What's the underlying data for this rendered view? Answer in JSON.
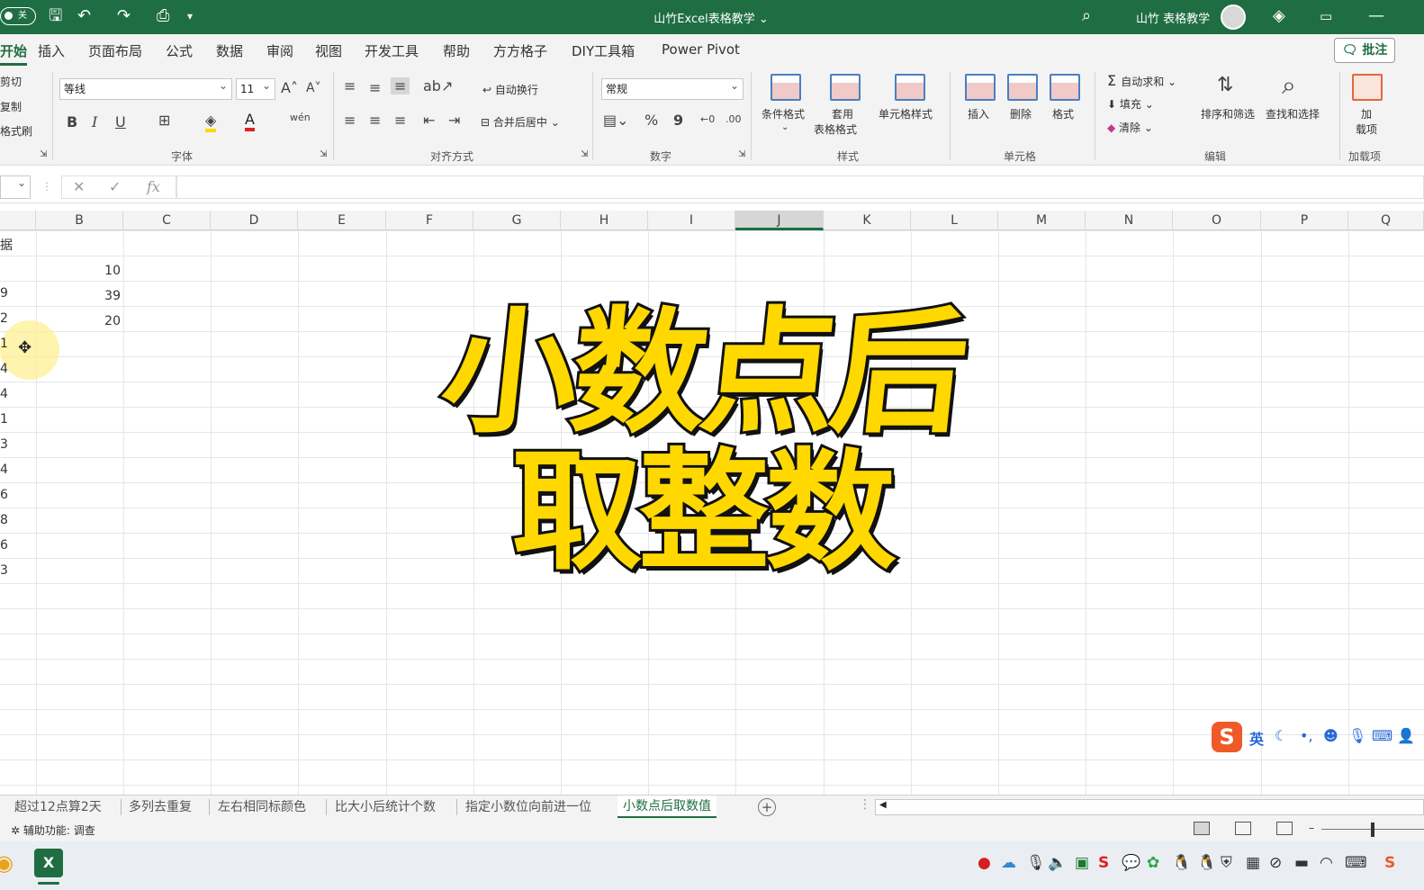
{
  "titlebar": {
    "autosave_toggle": "关",
    "doc_title": "山竹Excel表格教学 ⌄",
    "user_name": "山竹 表格教学"
  },
  "tabs": [
    "开始",
    "插入",
    "页面布局",
    "公式",
    "数据",
    "审阅",
    "视图",
    "开发工具",
    "帮助",
    "方方格子",
    "DIY工具箱",
    "Power Pivot"
  ],
  "comment_button": "批注",
  "clipboard": {
    "cut": "剪切",
    "copy": "复制",
    "format_painter": "格式刷"
  },
  "font": {
    "family": "等线",
    "size": "11",
    "bold": "B",
    "italic": "I",
    "underline": "U",
    "group_label": "字体"
  },
  "alignment": {
    "wrap_text": "自动换行",
    "merge_center": "合并后居中",
    "group_label": "对齐方式"
  },
  "number": {
    "format": "常规",
    "percent": "%",
    "comma": "9",
    "group_label": "数字"
  },
  "styles": {
    "conditional": "条件格式",
    "table_format_1": "套用",
    "table_format_2": "表格格式",
    "cell_styles": "单元格样式",
    "group_label": "样式"
  },
  "cells": {
    "insert": "插入",
    "delete": "删除",
    "format": "格式",
    "group_label": "单元格"
  },
  "editing": {
    "autosum": "自动求和",
    "fill": "填充",
    "clear": "清除",
    "sort_filter": "排序和筛选",
    "find_select": "查找和选择",
    "group_label": "编辑"
  },
  "addins": {
    "label_1": "加",
    "label_2": "载项",
    "group_label": "加载项"
  },
  "formula_bar": {
    "fx": "fx"
  },
  "columns": [
    "B",
    "C",
    "D",
    "E",
    "F",
    "G",
    "H",
    "I",
    "J",
    "K",
    "L",
    "M",
    "N",
    "O",
    "P",
    "Q"
  ],
  "selected_column": "J",
  "col_a_values": [
    "据",
    "",
    "9",
    "2",
    "1",
    "4",
    "4",
    "1",
    "3",
    "4",
    "6",
    "8",
    "6",
    "3"
  ],
  "col_b_values": [
    "10",
    "39",
    "20"
  ],
  "overlay": {
    "line1": "小数点后",
    "line2": "取整数"
  },
  "ime": {
    "logo": "S",
    "lang": "英"
  },
  "sheet_tabs": [
    "超过12点算2天",
    "多列去重复",
    "左右相同标颜色",
    "比大小后统计个数",
    "指定小数位向前进一位",
    "小数点后取数值"
  ],
  "active_sheet_index": 5,
  "status": {
    "accessibility": "辅助功能: 调查"
  },
  "taskbar": {
    "excel_letter": "X"
  },
  "colors": {
    "excel_green": "#1f6e43",
    "overlay_yellow": "#ffd800"
  }
}
